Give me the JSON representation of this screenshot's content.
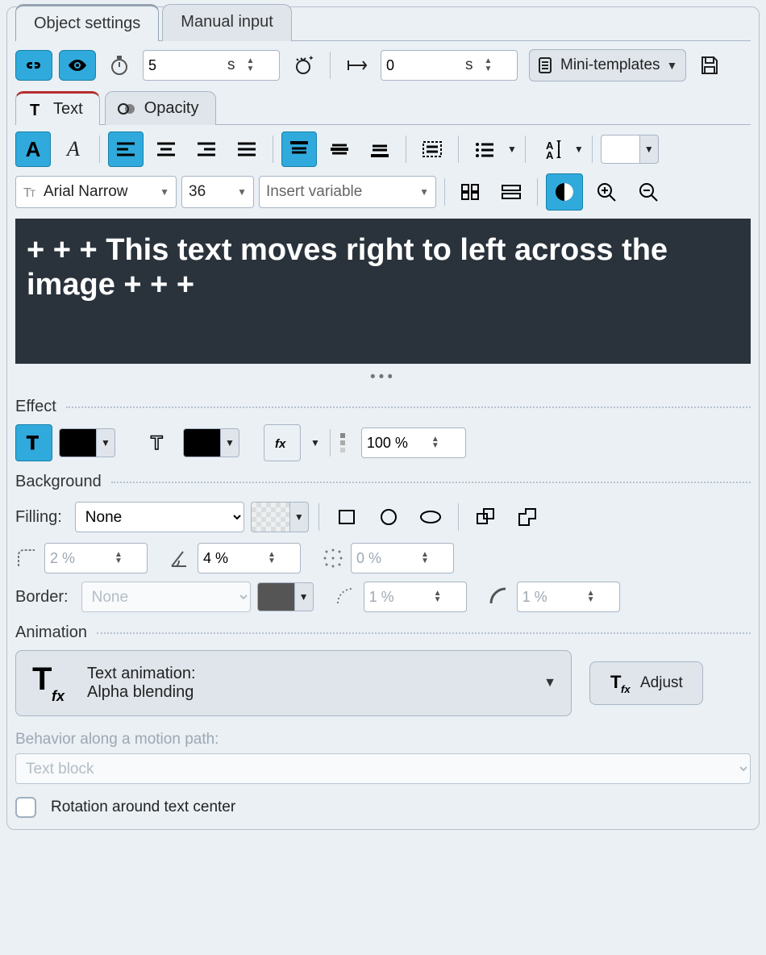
{
  "tabs": {
    "object": "Object settings",
    "manual": "Manual input"
  },
  "timing": {
    "duration_value": "5",
    "duration_unit": "s",
    "offset_value": "0",
    "offset_unit": "s"
  },
  "mini_templates_label": "Mini-templates",
  "subtabs": {
    "text": "Text",
    "opacity": "Opacity"
  },
  "font": {
    "family": "Arial Narrow",
    "size": "36",
    "insert_variable": "Insert variable"
  },
  "preview_text": "+ + + This text moves right to left across the image + + +",
  "sections": {
    "effect": "Effect",
    "background": "Background",
    "animation": "Animation"
  },
  "effect": {
    "opacity": "100 %"
  },
  "background": {
    "filling_label": "Filling:",
    "filling_value": "None",
    "radius": "2 %",
    "angle": "4 %",
    "spread": "0 %",
    "border_label": "Border:",
    "border_value": "None",
    "border_w": "1 %",
    "border_r": "1 %"
  },
  "animation": {
    "header": "Text animation:",
    "mode": "Alpha blending",
    "adjust": "Adjust",
    "behavior_label": "Behavior along a motion path:",
    "behavior_value": "Text block",
    "rotation": "Rotation around text center"
  }
}
